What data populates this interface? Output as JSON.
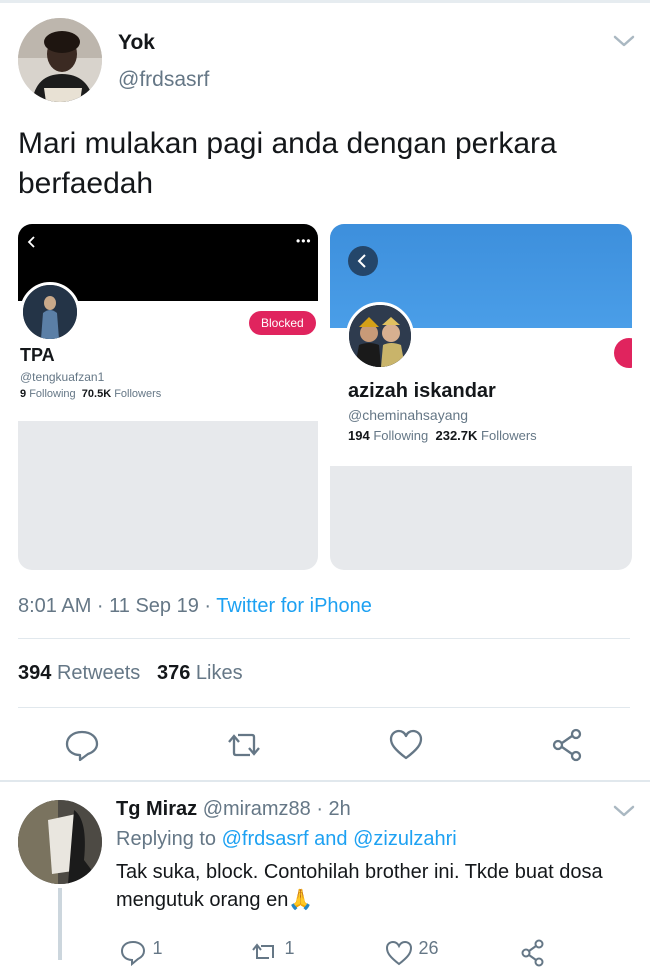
{
  "tweet": {
    "author_name": "Yok",
    "author_handle": "@frdsasrf",
    "text": "Mari mulakan pagi anda dengan perkara berfaedah",
    "time": "8:01 AM · 11 Sep 19 · ",
    "source": "Twitter for iPhone",
    "retweets_count": "394",
    "retweets_label": "Retweets",
    "likes_count": "376",
    "likes_label": "Likes"
  },
  "card_a": {
    "name": "TPA",
    "handle": "@tengkuafzan1",
    "following_count": "9",
    "following_label": "Following",
    "followers_count": "70.5K",
    "followers_label": "Followers",
    "blocked_label": "Blocked"
  },
  "card_b": {
    "name": "azizah iskandar",
    "handle": "@cheminahsayang",
    "following_count": "194",
    "following_label": "Following",
    "followers_count": "232.7K",
    "followers_label": "Followers"
  },
  "reply": {
    "name": "Tg Miraz",
    "handle_time": "@miramz88 · 2h",
    "replying_prefix": "Replying to ",
    "replying_to": "@frdsasrf and @zizulzahri",
    "text": "Tak suka, block. Contohilah brother ini. Tkde buat dosa mengutuk orang en🙏",
    "reply_count": "1",
    "retweet_count": "1",
    "like_count": "26"
  },
  "colors": {
    "accent": "#1da1f2",
    "blocked": "#e0245e",
    "text": "#14171a",
    "secondary": "#657786"
  }
}
